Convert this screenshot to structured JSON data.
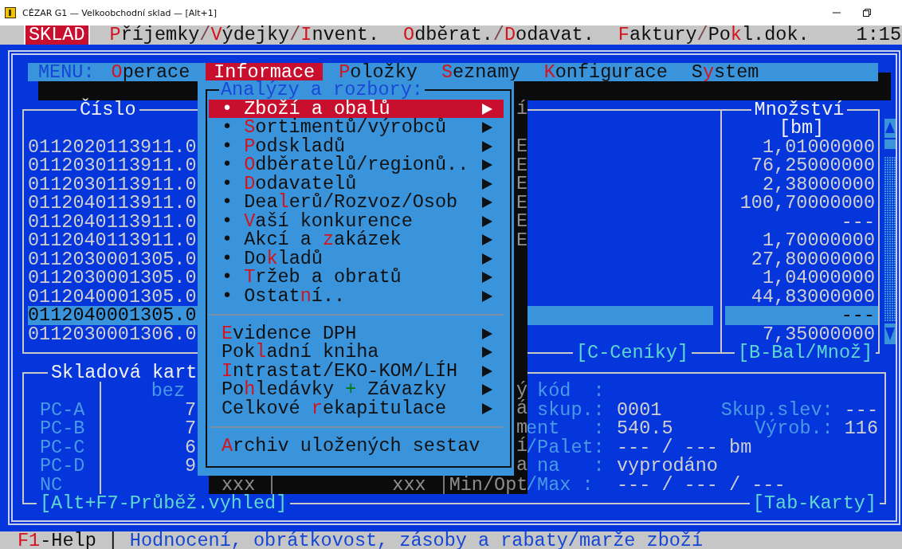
{
  "window": {
    "title": "CÉZAR G1 — Velkoobchodní sklad — [Alt+1]"
  },
  "top_bar": {
    "module": "SKLAD",
    "groups": [
      {
        "items": [
          {
            "kind": "link",
            "parts": [
              {
                "text": "P",
                "hot": true
              },
              {
                "text": "říjemky",
                "hot": false
              }
            ]
          },
          {
            "kind": "sep",
            "text": "/"
          },
          {
            "kind": "link",
            "parts": [
              {
                "text": "V",
                "hot": true
              },
              {
                "text": "ýdejky",
                "hot": false
              }
            ]
          },
          {
            "kind": "sep",
            "text": "/"
          },
          {
            "kind": "link",
            "parts": [
              {
                "text": "I",
                "hot": true
              },
              {
                "text": "nvent.",
                "hot": false
              }
            ]
          }
        ]
      },
      {
        "items": [
          {
            "kind": "link",
            "parts": [
              {
                "text": "O",
                "hot": true
              },
              {
                "text": "dběrat.",
                "hot": false
              }
            ]
          },
          {
            "kind": "sep",
            "text": "/"
          },
          {
            "kind": "link",
            "parts": [
              {
                "text": "D",
                "hot": true
              },
              {
                "text": "odavat.",
                "hot": false
              }
            ]
          }
        ]
      },
      {
        "items": [
          {
            "kind": "link",
            "parts": [
              {
                "text": "F",
                "hot": true
              },
              {
                "text": "aktury",
                "hot": false
              }
            ]
          },
          {
            "kind": "sep",
            "text": "/"
          },
          {
            "kind": "link",
            "parts": [
              {
                "text": "Po",
                "hot": false
              },
              {
                "text": "k",
                "hot": true
              },
              {
                "text": "l.dok.",
                "hot": false
              }
            ]
          }
        ]
      }
    ],
    "time": "1:15"
  },
  "menu_bar": {
    "label": "MENU:",
    "items": [
      {
        "parts": [
          {
            "text": "O",
            "hot": true
          },
          {
            "text": "perace",
            "hot": false
          }
        ],
        "selected": false
      },
      {
        "parts": [
          {
            "text": "Informace"
          }
        ],
        "selected": true
      },
      {
        "parts": [
          {
            "text": "P",
            "hot": true
          },
          {
            "text": "oložky",
            "hot": false
          }
        ],
        "selected": false
      },
      {
        "parts": [
          {
            "text": "S",
            "hot": true
          },
          {
            "text": "eznamy",
            "hot": false
          }
        ],
        "selected": false
      },
      {
        "parts": [
          {
            "text": "K",
            "hot": true
          },
          {
            "text": "onfigurace",
            "hot": false
          }
        ],
        "selected": false
      },
      {
        "parts": [
          {
            "text": "S",
            "hot": false
          },
          {
            "text": "y",
            "hot": true
          },
          {
            "text": "stem",
            "hot": false
          }
        ],
        "selected": false
      }
    ]
  },
  "dropdown": {
    "title": "Analýzy a rozbory:",
    "items": [
      {
        "kind": "item",
        "marker": "•",
        "parts": [
          {
            "text": "Zboží a obalů"
          }
        ],
        "submenu": true,
        "selected": true
      },
      {
        "kind": "item",
        "marker": "•",
        "parts": [
          {
            "text": "S",
            "hot": true
          },
          {
            "text": "ortimentů/výrobců",
            "hot": false
          }
        ],
        "submenu": true,
        "selected": false
      },
      {
        "kind": "item",
        "marker": "•",
        "parts": [
          {
            "text": "P",
            "hot": true
          },
          {
            "text": "odskladů",
            "hot": false
          }
        ],
        "submenu": true,
        "selected": false
      },
      {
        "kind": "item",
        "marker": "•",
        "parts": [
          {
            "text": "O",
            "hot": true
          },
          {
            "text": "dběratelů/regionů..",
            "hot": false
          }
        ],
        "submenu": true,
        "selected": false
      },
      {
        "kind": "item",
        "marker": "•",
        "parts": [
          {
            "text": "D",
            "hot": true
          },
          {
            "text": "odavatelů",
            "hot": false
          }
        ],
        "submenu": true,
        "selected": false
      },
      {
        "kind": "item",
        "marker": "•",
        "parts": [
          {
            "text": "Dea",
            "hot": false
          },
          {
            "text": "l",
            "hot": true
          },
          {
            "text": "erů/Rozvoz/Osob",
            "hot": false
          }
        ],
        "submenu": true,
        "selected": false
      },
      {
        "kind": "item",
        "marker": "•",
        "parts": [
          {
            "text": "V",
            "hot": true
          },
          {
            "text": "aší konkurence",
            "hot": false
          }
        ],
        "submenu": true,
        "selected": false
      },
      {
        "kind": "item",
        "marker": "•",
        "parts": [
          {
            "text": "Akcí a ",
            "hot": false
          },
          {
            "text": "z",
            "hot": true
          },
          {
            "text": "akázek",
            "hot": false
          }
        ],
        "submenu": true,
        "selected": false
      },
      {
        "kind": "item",
        "marker": "•",
        "parts": [
          {
            "text": "Do",
            "hot": false
          },
          {
            "text": "k",
            "hot": true
          },
          {
            "text": "ladů",
            "hot": false
          }
        ],
        "submenu": true,
        "selected": false
      },
      {
        "kind": "item",
        "marker": "•",
        "parts": [
          {
            "text": "T",
            "hot": true
          },
          {
            "text": "ržeb a obratů",
            "hot": false
          }
        ],
        "submenu": true,
        "selected": false
      },
      {
        "kind": "item",
        "marker": "•",
        "parts": [
          {
            "text": "Ostat",
            "hot": false
          },
          {
            "text": "n",
            "hot": true
          },
          {
            "text": "í..",
            "hot": false
          }
        ],
        "submenu": true,
        "selected": false
      },
      {
        "kind": "separator"
      },
      {
        "kind": "item",
        "parts": [
          {
            "text": "E",
            "hot": true
          },
          {
            "text": "vidence DPH",
            "hot": false
          }
        ],
        "submenu": true,
        "selected": false
      },
      {
        "kind": "item",
        "parts": [
          {
            "text": "Pok",
            "hot": false
          },
          {
            "text": "l",
            "hot": true
          },
          {
            "text": "adní kniha",
            "hot": false
          }
        ],
        "submenu": true,
        "selected": false
      },
      {
        "kind": "item",
        "parts": [
          {
            "text": "I",
            "hot": true
          },
          {
            "text": "ntrastat/EKO-KOM/LÍH",
            "hot": false
          }
        ],
        "submenu": true,
        "selected": false
      },
      {
        "kind": "item",
        "parts": [
          {
            "text": "Po",
            "hot": false
          },
          {
            "text": "h",
            "hot": true
          },
          {
            "text": "ledávky ",
            "hot": false
          },
          {
            "text": "+",
            "color": "#007a00"
          },
          {
            "text": " Závazky",
            "hot": false
          }
        ],
        "submenu": true,
        "selected": false
      },
      {
        "kind": "item",
        "parts": [
          {
            "text": "Celkové ",
            "hot": false
          },
          {
            "text": "r",
            "hot": true
          },
          {
            "text": "ekapitulace",
            "hot": false
          }
        ],
        "submenu": true,
        "selected": false
      },
      {
        "kind": "separator"
      },
      {
        "kind": "item",
        "parts": [
          {
            "text": "A",
            "hot": true
          },
          {
            "text": "rchiv uložených sestav",
            "hot": false
          }
        ],
        "submenu": false,
        "selected": false
      }
    ]
  },
  "list": {
    "columns": [
      {
        "label": "Číslo"
      },
      {
        "label": "í"
      },
      {
        "label": "Množství",
        "unit": "[bm]"
      }
    ],
    "rows": [
      {
        "code": "0112020113911.0",
        "flag": "E",
        "quantity": "1,01000000",
        "selected": false
      },
      {
        "code": "0112030113911.0",
        "flag": "E",
        "quantity": "76,25000000",
        "selected": false
      },
      {
        "code": "0112030113911.0",
        "flag": "E",
        "quantity": "2,38000000",
        "selected": false
      },
      {
        "code": "0112040113911.0",
        "flag": "E",
        "quantity": "100,70000000",
        "selected": false
      },
      {
        "code": "0112040113911.0",
        "flag": "E",
        "quantity": "---",
        "selected": false
      },
      {
        "code": "0112040113911.0",
        "flag": "E",
        "quantity": "1,70000000",
        "selected": false
      },
      {
        "code": "0112030001305.0",
        "quantity": "27,80000000",
        "selected": false
      },
      {
        "code": "0112030001305.0",
        "quantity": "1,04000000",
        "selected": false
      },
      {
        "code": "0112040001305.0",
        "quantity": "44,83000000",
        "selected": false
      },
      {
        "code": "0112040001305.0",
        "quantity": "---",
        "selected": true
      },
      {
        "code": "0112030001306.0",
        "quantity": "7,35000000",
        "selected": false
      }
    ],
    "footer": [
      "[C-Ceníky]",
      "[B-Bal/Množ]"
    ]
  },
  "card": {
    "title": "Skladová kart",
    "note": "bez",
    "prices": [
      {
        "label": "PC-A",
        "value": "7"
      },
      {
        "label": "PC-B",
        "value": "7"
      },
      {
        "label": "PC-C",
        "value": "6"
      },
      {
        "label": "PC-D",
        "value": "9"
      },
      {
        "label": "NC"
      }
    ],
    "fields": [
      {
        "shaded": "ý",
        "label": " kód  :"
      },
      {
        "shaded": "á",
        "label": " skup.:",
        "value": "0001",
        "extra_label": "Skup.slev:",
        "extra_value": "---"
      },
      {
        "shaded": "m",
        "label": "ent   :",
        "value": "540.5",
        "extra_label": "Výrob.:",
        "extra_value": "116"
      },
      {
        "shaded": "í",
        "label": "/Palet:",
        "value": "--- / --- bm"
      },
      {
        "shaded": "a",
        "label": " na   :",
        "value": "vyprodáno"
      },
      {
        "shaded": "Min/Opt",
        "label": "/Max :",
        "value": "--- / --- / ---"
      }
    ],
    "shadow_cells": [
      "xxx",
      "xxx"
    ],
    "footer": [
      "[Alt+F7-Průběž.vyhled]",
      "[Tab-Karty]"
    ]
  },
  "status_bar": {
    "key": "F1",
    "label": "-Help",
    "separator": "|",
    "hint": "Hodnocení, obrátkovost, zásoby a rabaty/marže zboží"
  }
}
